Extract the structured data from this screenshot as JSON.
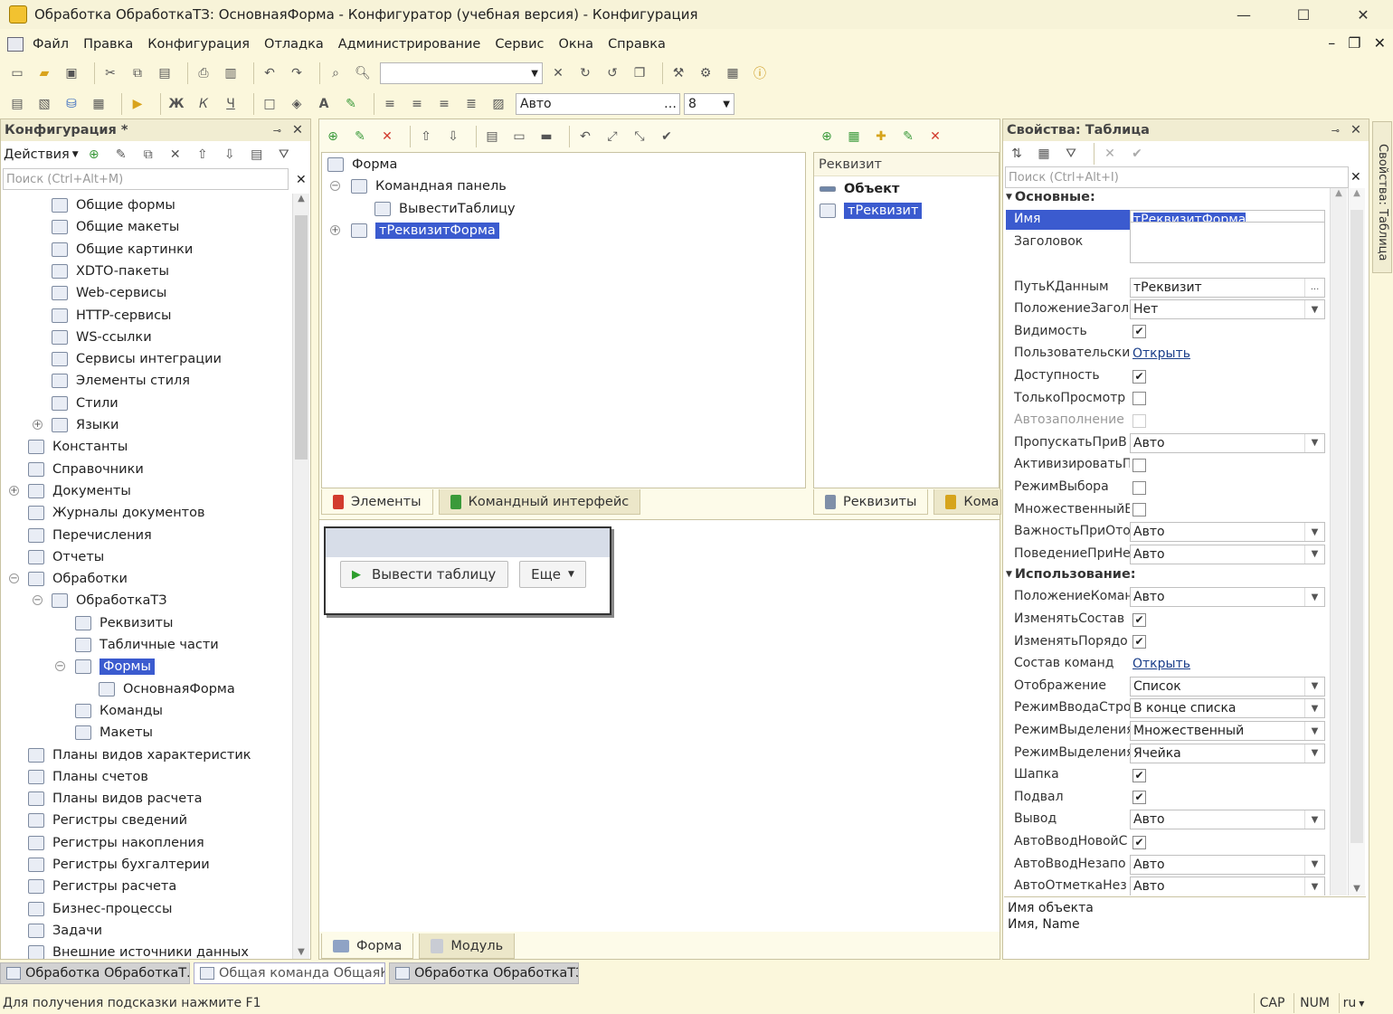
{
  "window": {
    "title": "Обработка ОбработкаТЗ: ОсновнаяФорма - Конфигуратор (учебная версия) - Конфигурация",
    "minimize": "—",
    "maximize": "☐",
    "close": "✕"
  },
  "menu": [
    "Файл",
    "Правка",
    "Конфигурация",
    "Отладка",
    "Администрирование",
    "Сервис",
    "Окна",
    "Справка"
  ],
  "toolbar2": {
    "font_value": "Авто",
    "font_size": "8"
  },
  "config_panel": {
    "title": "Конфигурация *",
    "actions_label": "Действия",
    "search_placeholder": "Поиск (Ctrl+Alt+M)",
    "tree": [
      {
        "label": "Общие формы",
        "level": 2
      },
      {
        "label": "Общие макеты",
        "level": 2
      },
      {
        "label": "Общие картинки",
        "level": 2
      },
      {
        "label": "XDTO-пакеты",
        "level": 2
      },
      {
        "label": "Web-сервисы",
        "level": 2
      },
      {
        "label": "HTTP-сервисы",
        "level": 2
      },
      {
        "label": "WS-ссылки",
        "level": 2
      },
      {
        "label": "Сервисы интеграции",
        "level": 2
      },
      {
        "label": "Элементы стиля",
        "level": 2
      },
      {
        "label": "Стили",
        "level": 2
      },
      {
        "label": "Языки",
        "level": 2,
        "expander": "+"
      },
      {
        "label": "Константы",
        "level": 1
      },
      {
        "label": "Справочники",
        "level": 1
      },
      {
        "label": "Документы",
        "level": 1,
        "expander": "+"
      },
      {
        "label": "Журналы документов",
        "level": 1
      },
      {
        "label": "Перечисления",
        "level": 1
      },
      {
        "label": "Отчеты",
        "level": 1
      },
      {
        "label": "Обработки",
        "level": 1,
        "expander": "−"
      },
      {
        "label": "ОбработкаТЗ",
        "level": 2,
        "expander": "−"
      },
      {
        "label": "Реквизиты",
        "level": 3
      },
      {
        "label": "Табличные части",
        "level": 3
      },
      {
        "label": "Формы",
        "level": 3,
        "expander": "−",
        "selected": true
      },
      {
        "label": "ОсновнаяФорма",
        "level": 4
      },
      {
        "label": "Команды",
        "level": 3
      },
      {
        "label": "Макеты",
        "level": 3
      },
      {
        "label": "Планы видов характеристик",
        "level": 1
      },
      {
        "label": "Планы счетов",
        "level": 1
      },
      {
        "label": "Планы видов расчета",
        "level": 1
      },
      {
        "label": "Регистры сведений",
        "level": 1
      },
      {
        "label": "Регистры накопления",
        "level": 1
      },
      {
        "label": "Регистры бухгалтерии",
        "level": 1
      },
      {
        "label": "Регистры расчета",
        "level": 1
      },
      {
        "label": "Бизнес-процессы",
        "level": 1
      },
      {
        "label": "Задачи",
        "level": 1
      },
      {
        "label": "Внешние источники данных",
        "level": 1
      }
    ]
  },
  "elements_panel": {
    "tree": [
      {
        "label": "Форма",
        "level": 0
      },
      {
        "label": "Командная панель",
        "level": 1,
        "expander": "−"
      },
      {
        "label": "ВывестиТаблицу",
        "level": 2
      },
      {
        "label": "тРеквизитФорма",
        "level": 1,
        "expander": "+",
        "selected": true
      }
    ],
    "tabs": [
      "Элементы",
      "Командный интерфейс"
    ]
  },
  "requisites_panel": {
    "header": "Реквизит",
    "items": [
      {
        "label": "Объект",
        "bold": true
      },
      {
        "label": "тРеквизит",
        "selected": true
      }
    ],
    "tabs": [
      "Реквизиты",
      "Кома"
    ]
  },
  "preview": {
    "button_label": "Вывести таблицу",
    "more_label": "Еще"
  },
  "bottom_tabs": [
    "Форма",
    "Модуль"
  ],
  "properties": {
    "title": "Свойства: Таблица",
    "search_placeholder": "Поиск (Ctrl+Alt+I)",
    "side_tab": "Свойства: Таблица",
    "section_main": "Основные:",
    "section_usage": "Использование:",
    "rows_main": [
      {
        "name": "Имя",
        "type": "field",
        "value": "тРеквизитФорма",
        "selected": true
      },
      {
        "name": "Заголовок",
        "type": "textarea",
        "value": ""
      },
      {
        "name": "ПутьКДанным",
        "type": "field",
        "value": "тРеквизит",
        "button": "..."
      },
      {
        "name": "ПоложениеЗагол",
        "type": "select",
        "value": "Нет"
      },
      {
        "name": "Видимость",
        "type": "check",
        "checked": true
      },
      {
        "name": "Пользовательские",
        "type": "link",
        "value": "Открыть"
      },
      {
        "name": "Доступность",
        "type": "check",
        "checked": true
      },
      {
        "name": "ТолькоПросмотр",
        "type": "check",
        "checked": false
      },
      {
        "name": "Автозаполнение",
        "type": "check",
        "checked": false,
        "disabled": true
      },
      {
        "name": "ПропускатьПриВ",
        "type": "select",
        "value": "Авто"
      },
      {
        "name": "АктивизироватьП",
        "type": "check",
        "checked": false
      },
      {
        "name": "РежимВыбора",
        "type": "check",
        "checked": false
      },
      {
        "name": "МножественныйВ",
        "type": "check",
        "checked": false
      },
      {
        "name": "ВажностьПриОто",
        "type": "select",
        "value": "Авто"
      },
      {
        "name": "ПоведениеПриНе",
        "type": "select",
        "value": "Авто"
      }
    ],
    "rows_usage": [
      {
        "name": "ПоложениеКоман",
        "type": "select",
        "value": "Авто"
      },
      {
        "name": "ИзменятьСостав",
        "type": "check",
        "checked": true
      },
      {
        "name": "ИзменятьПорядо",
        "type": "check",
        "checked": true
      },
      {
        "name": "Состав команд",
        "type": "link",
        "value": "Открыть"
      },
      {
        "name": "Отображение",
        "type": "select",
        "value": "Список"
      },
      {
        "name": "РежимВводаСтро",
        "type": "select",
        "value": "В конце списка"
      },
      {
        "name": "РежимВыделения",
        "type": "select",
        "value": "Множественный"
      },
      {
        "name": "РежимВыделения",
        "type": "select",
        "value": "Ячейка"
      },
      {
        "name": "Шапка",
        "type": "check",
        "checked": true
      },
      {
        "name": "Подвал",
        "type": "check",
        "checked": true
      },
      {
        "name": "Вывод",
        "type": "select",
        "value": "Авто"
      },
      {
        "name": "АвтоВводНовойС",
        "type": "check",
        "checked": true
      },
      {
        "name": "АвтоВводНезапо",
        "type": "select",
        "value": "Авто"
      },
      {
        "name": "АвтоОтметкаНез",
        "type": "select",
        "value": "Авто"
      }
    ],
    "description_line1": "Имя объекта",
    "description_line2": "Имя, Name"
  },
  "taskbar": [
    {
      "label": "Обработка ОбработкаТ...",
      "active": false
    },
    {
      "label": "Общая команда ОбщаяК...",
      "active": true
    },
    {
      "label": "Обработка ОбработкаТЗ",
      "active": false
    }
  ],
  "status": {
    "hint": "Для получения подсказки нажмите F1",
    "cap": "CAP",
    "num": "NUM",
    "lang": "ru"
  }
}
